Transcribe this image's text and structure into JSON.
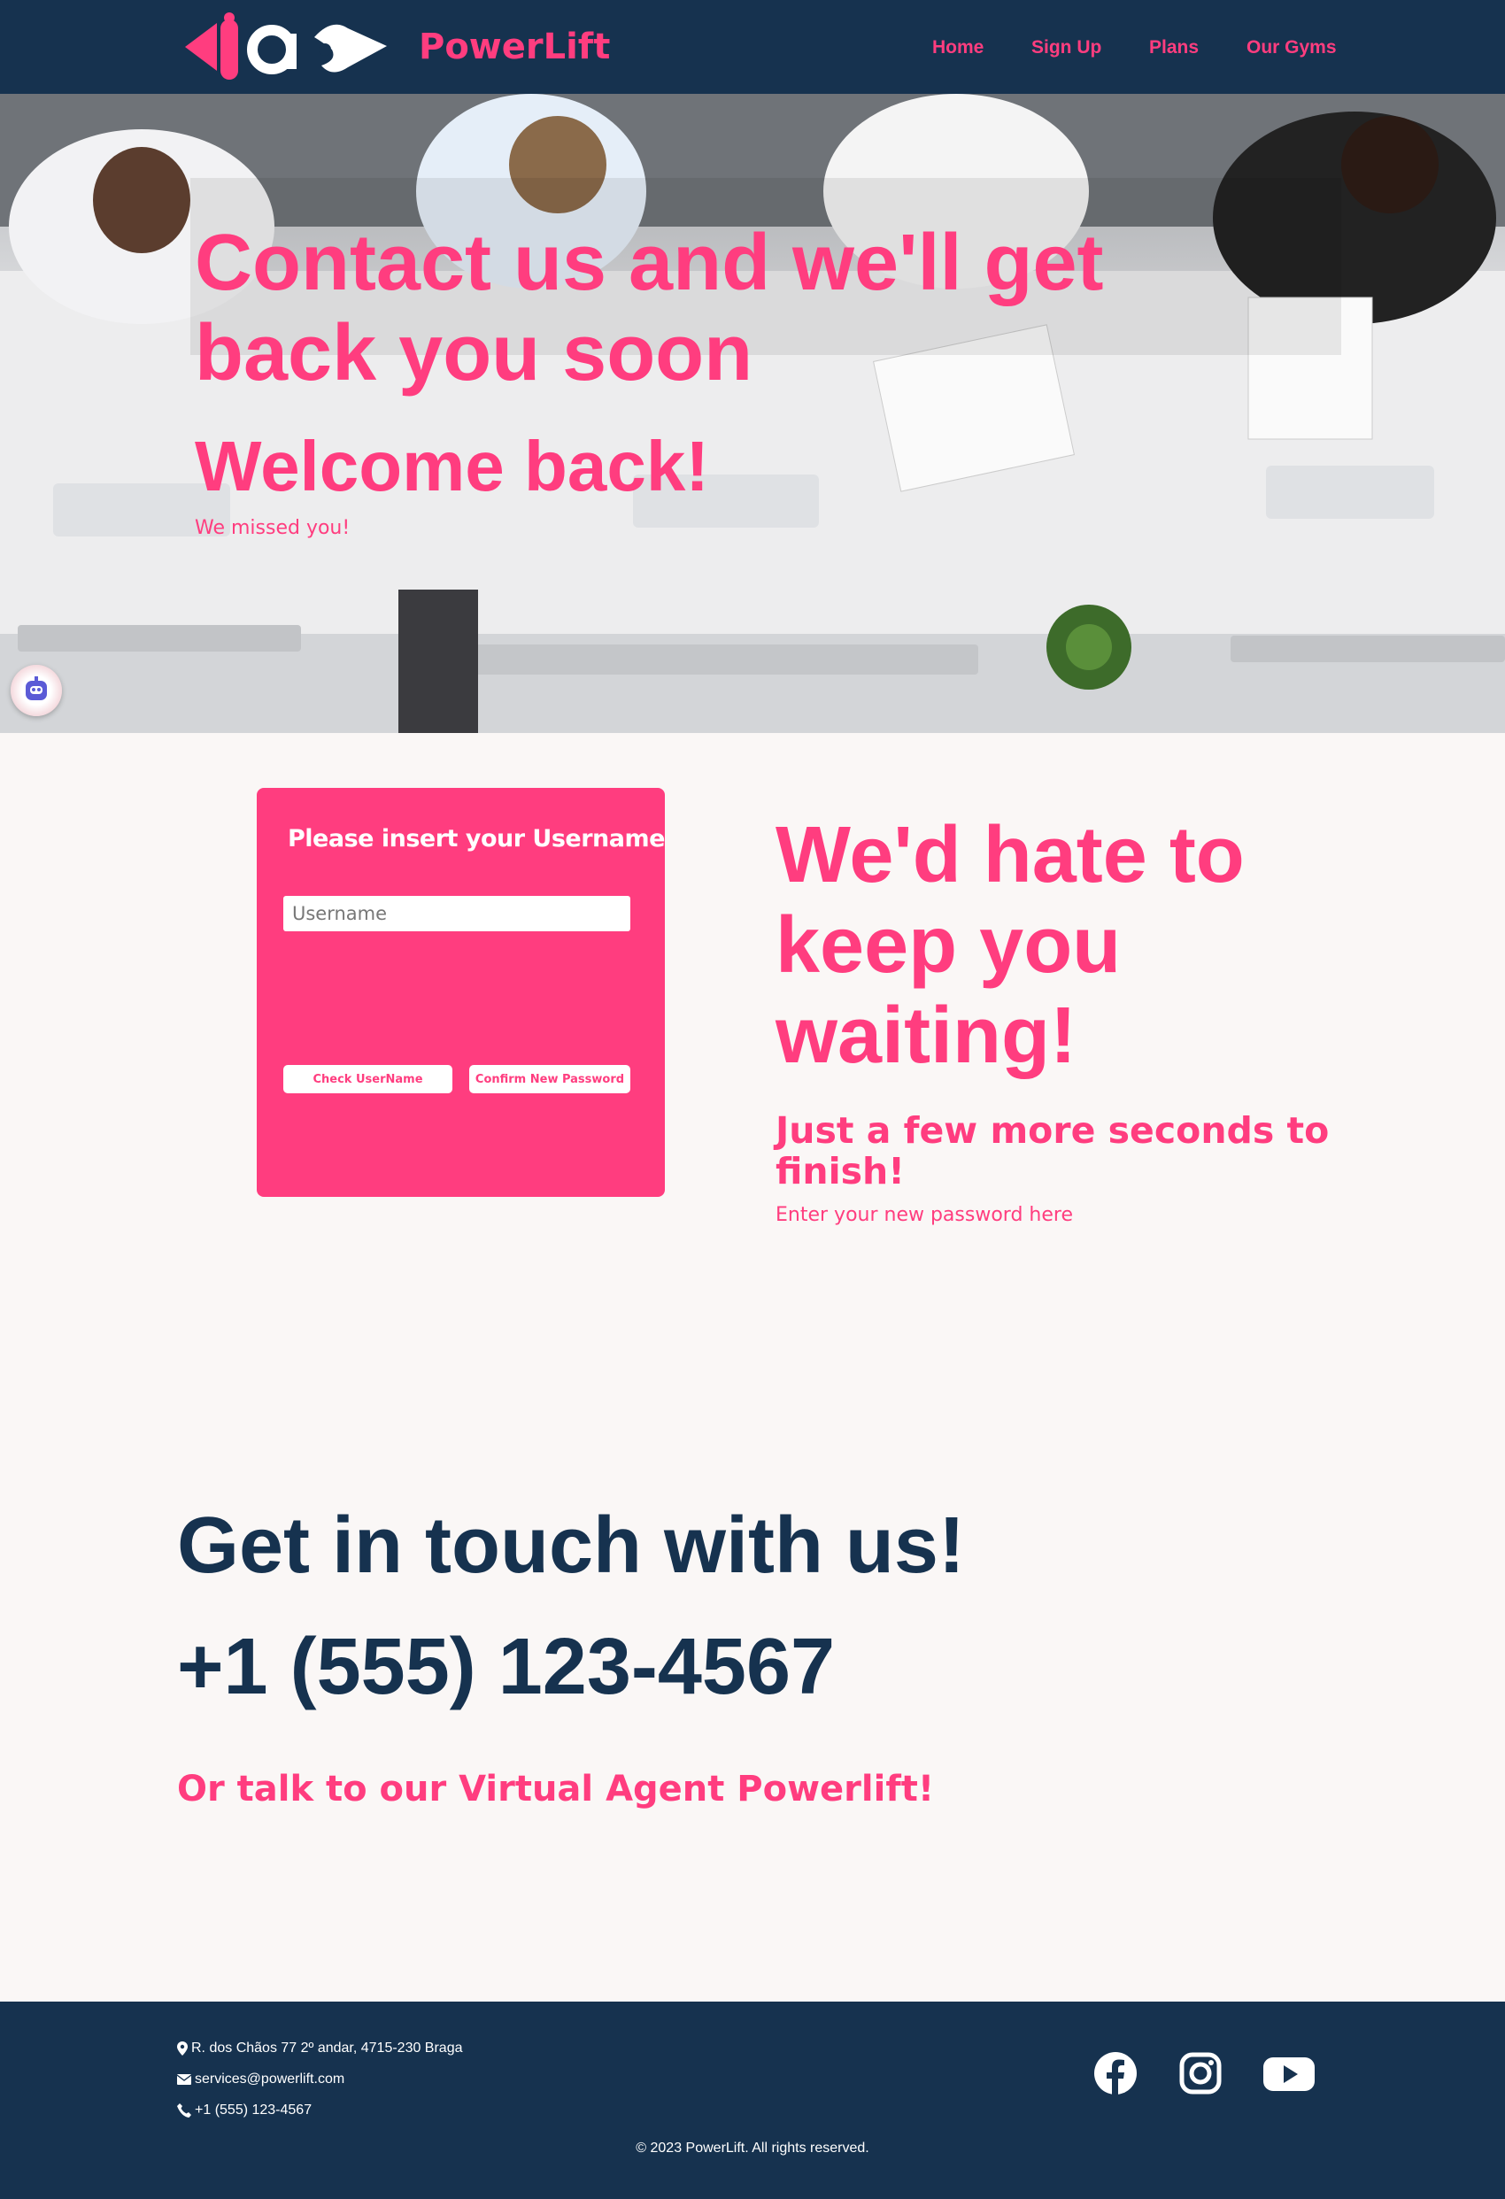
{
  "nav": {
    "brand": "PowerLift",
    "links": [
      "Home",
      "Sign Up",
      "Plans",
      "Our Gyms"
    ]
  },
  "hero": {
    "title": "Contact us and we'll get back you soon",
    "welcome": "Welcome back!",
    "missed": "We missed you!"
  },
  "form": {
    "title": "Please insert your Username",
    "username_placeholder": "Username",
    "username_value": "",
    "check_button": "Check UserName",
    "confirm_button": "Confirm New Password"
  },
  "waiting": {
    "title": "We'd hate to keep you waiting!",
    "subtitle": "Just a few more seconds to finish!",
    "hint": "Enter your new password here"
  },
  "contact": {
    "title": "Get in touch with us!",
    "phone": "+1 (555) 123-4567",
    "agent": "Or talk to our Virtual Agent Powerlift!"
  },
  "footer": {
    "address": "R. dos Chãos 77 2º andar, 4715-230 Braga",
    "email": "services@powerlift.com",
    "phone": "+1 (555) 123-4567",
    "copyright": "© 2023 PowerLift. All rights reserved.",
    "social": [
      "facebook-icon",
      "instagram-icon",
      "youtube-icon"
    ]
  },
  "colors": {
    "navy": "#16324f",
    "pink": "#ff3d7f",
    "background": "#faf7f6"
  }
}
